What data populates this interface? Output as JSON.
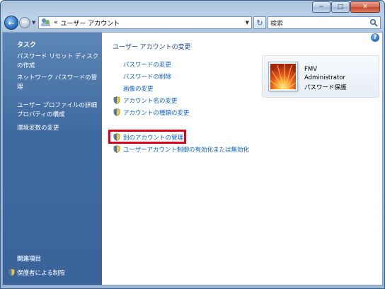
{
  "window": {
    "title_buttons": {
      "minimize": "─",
      "maximize": "□",
      "close": "✕"
    }
  },
  "address_bar": {
    "back_glyph": "←",
    "forward_glyph": "→",
    "chevron": "«",
    "path": "ユーザー アカウント",
    "search_placeholder": "検索"
  },
  "sidebar": {
    "heading": "タスク",
    "items": [
      {
        "label": "パスワード リセット ディスクの作成"
      },
      {
        "label": "ネットワーク パスワードの管理"
      },
      {
        "label": "ユーザー プロファイルの詳細プロパティの構成"
      },
      {
        "label": "環境変数の変更"
      }
    ],
    "related_heading": "関連項目",
    "related_items": [
      {
        "label": "保護者による制限"
      }
    ]
  },
  "main": {
    "help_glyph": "?",
    "title": "ユーザー アカウントの変更",
    "links": [
      {
        "label": "パスワードの変更",
        "shield": false
      },
      {
        "label": "パスワードの削除",
        "shield": false
      },
      {
        "label": "画像の変更",
        "shield": false
      },
      {
        "label": "アカウント名の変更",
        "shield": true
      },
      {
        "label": "アカウントの種類の変更",
        "shield": true
      }
    ],
    "links2": [
      {
        "label": "別のアカウントの管理",
        "shield": true,
        "highlighted": true
      },
      {
        "label": "ユーザーアカウント制御の有効化または無効化",
        "shield": true
      }
    ]
  },
  "user_card": {
    "name": "FMV",
    "role": "Administrator",
    "status": "パスワード保護"
  },
  "colors": {
    "sidebar_top": "#5c86b5",
    "link_blue": "#0b5fc5",
    "title_blue": "#1a3f9f",
    "highlight_red": "#e4001a"
  },
  "icons": {
    "shield": "uac-shield-icon",
    "help": "help-icon",
    "search": "search-icon",
    "refresh": "refresh-icon"
  }
}
